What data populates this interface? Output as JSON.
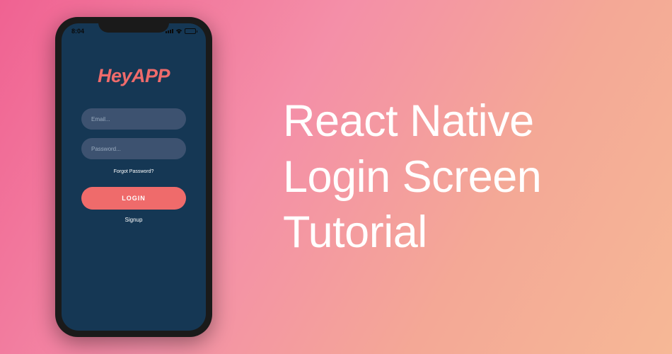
{
  "phone": {
    "status_bar": {
      "time": "8:04"
    },
    "app": {
      "logo": "HeyAPP",
      "email_placeholder": "Email...",
      "password_placeholder": "Password...",
      "forgot_password": "Forgot Password?",
      "login_button": "LOGIN",
      "signup_link": "Signup"
    }
  },
  "title": {
    "line1": "React Native",
    "line2": "Login Screen",
    "line3": "Tutorial"
  },
  "colors": {
    "phone_bg": "#153754",
    "input_bg": "#3d5270",
    "accent": "#ef6b6b",
    "gradient_start": "#f06292",
    "gradient_end": "#f6b896"
  }
}
